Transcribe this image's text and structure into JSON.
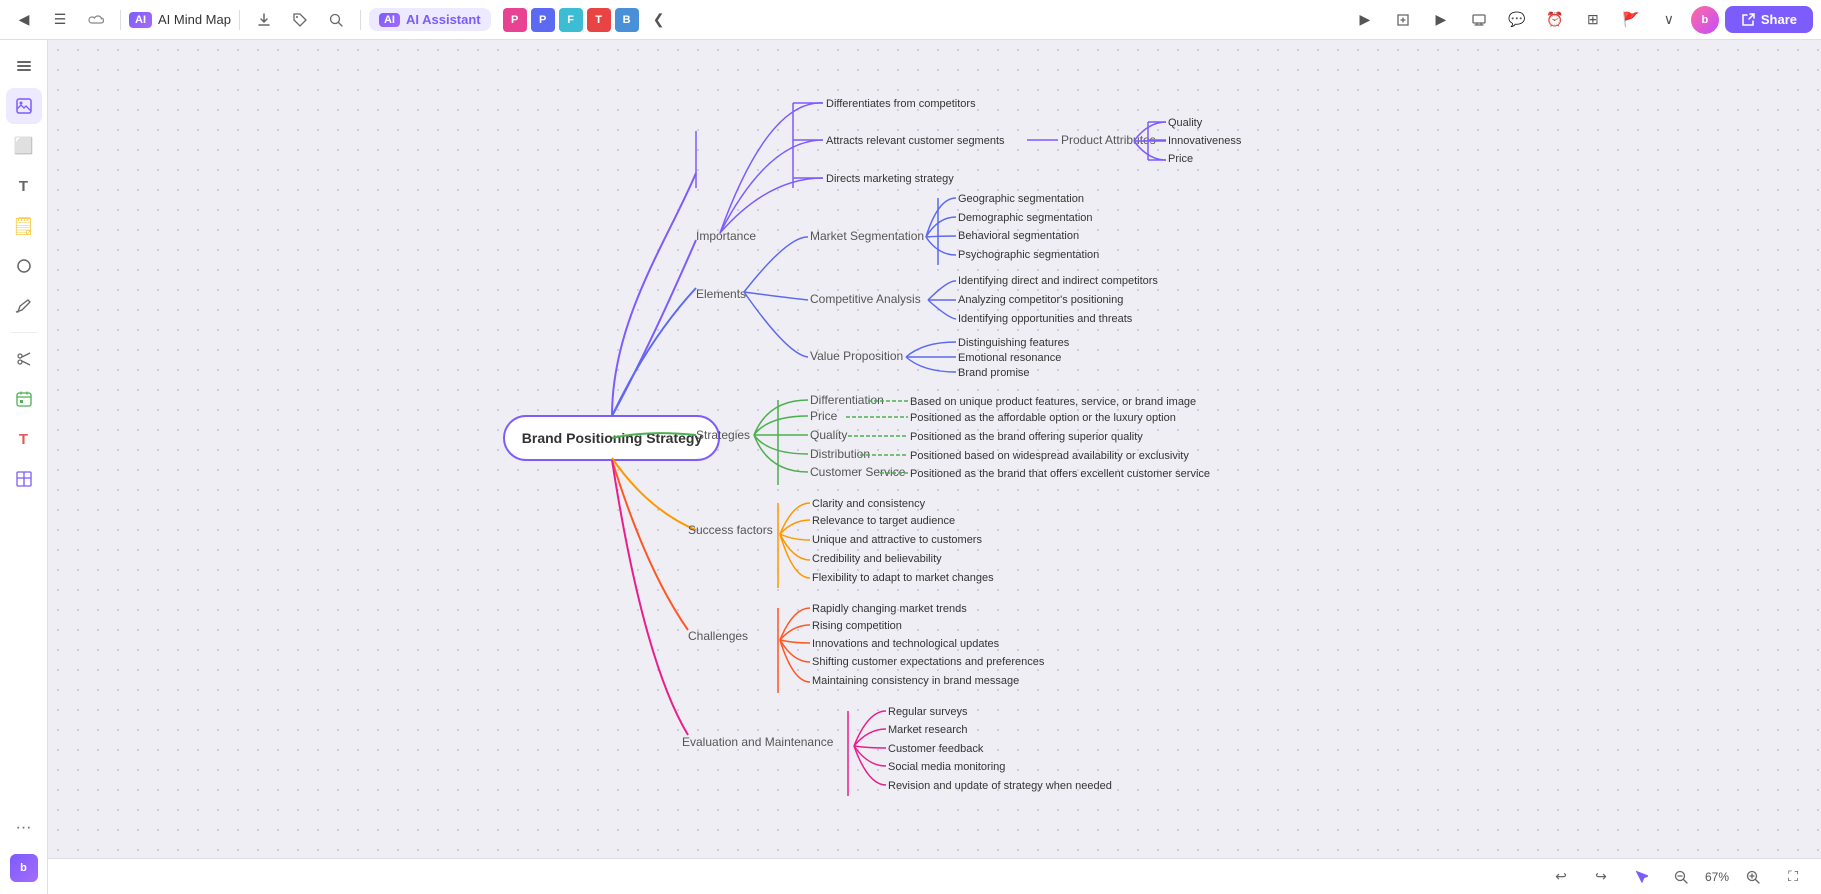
{
  "toolbar": {
    "back_icon": "◀",
    "menu_icon": "☰",
    "cloud_icon": "☁",
    "title": "AI Mind Map",
    "download_icon": "⬇",
    "tag_icon": "🏷",
    "search_icon": "🔍",
    "ai_label": "AI Assistant",
    "app_icons": [
      {
        "label": "P",
        "color": "#e84393"
      },
      {
        "label": "P",
        "color": "#5b6af0"
      },
      {
        "label": "F",
        "color": "#3dbdd4"
      },
      {
        "label": "T",
        "color": "#e84444"
      },
      {
        "label": "B",
        "color": "#4a90d9"
      }
    ],
    "collapse_icon": "❮",
    "share_icon": "👤",
    "share_label": "Share"
  },
  "sidebar": {
    "items": [
      {
        "icon": "◀",
        "name": "back"
      },
      {
        "icon": "☰",
        "name": "layers"
      },
      {
        "icon": "⬜",
        "name": "frame"
      },
      {
        "icon": "T",
        "name": "text"
      },
      {
        "icon": "🗒",
        "name": "sticky"
      },
      {
        "icon": "○",
        "name": "shapes"
      },
      {
        "icon": "✏",
        "name": "pen"
      },
      {
        "icon": "✂",
        "name": "scissors"
      },
      {
        "icon": "🗓",
        "name": "calendar"
      },
      {
        "icon": "T",
        "name": "text2"
      },
      {
        "icon": "▦",
        "name": "table"
      },
      {
        "icon": "···",
        "name": "more"
      },
      {
        "icon": "b",
        "name": "brand"
      }
    ]
  },
  "central_node": {
    "label": "Brand Positioning Strategy"
  },
  "branches": {
    "importance": {
      "label": "Importance",
      "color": "#7c5cfc",
      "children": [
        "Differentiates from competitors",
        "Attracts relevant customer segments",
        "Directs marketing strategy"
      ],
      "sub": {
        "label": "Product Attributes",
        "children": [
          "Quality",
          "Innovativeness",
          "Price"
        ]
      }
    },
    "elements": {
      "label": "Elements",
      "color": "#5b6af0",
      "children": [
        {
          "label": "Market Segmentation",
          "items": [
            "Geographic segmentation",
            "Demographic segmentation",
            "Behavioral segmentation",
            "Psychographic segmentation"
          ]
        },
        {
          "label": "Competitive Analysis",
          "items": [
            "Identifying direct and indirect competitors",
            "Analyzing competitor's positioning",
            "Identifying opportunities and threats"
          ]
        },
        {
          "label": "Value Proposition",
          "items": [
            "Distinguishing features",
            "Emotional resonance",
            "Brand promise"
          ]
        }
      ]
    },
    "strategies": {
      "label": "Strategies",
      "color": "#4caf50",
      "children": [
        {
          "label": "Differentiation",
          "desc": "Based on unique product features, service, or brand image"
        },
        {
          "label": "Price",
          "desc": "Positioned as the affordable option or the luxury option"
        },
        {
          "label": "Quality",
          "desc": "Positioned as the brand offering superior quality"
        },
        {
          "label": "Distribution",
          "desc": "Positioned based on widespread availability or exclusivity"
        },
        {
          "label": "Customer Service",
          "desc": "Positioned as the brand that offers excellent customer service"
        }
      ]
    },
    "success_factors": {
      "label": "Success factors",
      "color": "#ff9800",
      "children": [
        "Clarity and consistency",
        "Relevance to target audience",
        "Unique and attractive to customers",
        "Credibility and believability",
        "Flexibility to adapt to market changes"
      ]
    },
    "challenges": {
      "label": "Challenges",
      "color": "#ff5722",
      "children": [
        "Rapidly changing market trends",
        "Rising competition",
        "Innovations and technological updates",
        "Shifting customer expectations and preferences",
        "Maintaining consistency in brand message"
      ]
    },
    "evaluation": {
      "label": "Evaluation and Maintenance",
      "color": "#e91e8c",
      "children": [
        "Regular surveys",
        "Market research",
        "Customer feedback",
        "Social media monitoring",
        "Revision and update of strategy when needed"
      ]
    }
  },
  "bottom": {
    "zoom": "67%",
    "undo_icon": "↩",
    "redo_icon": "↪"
  }
}
